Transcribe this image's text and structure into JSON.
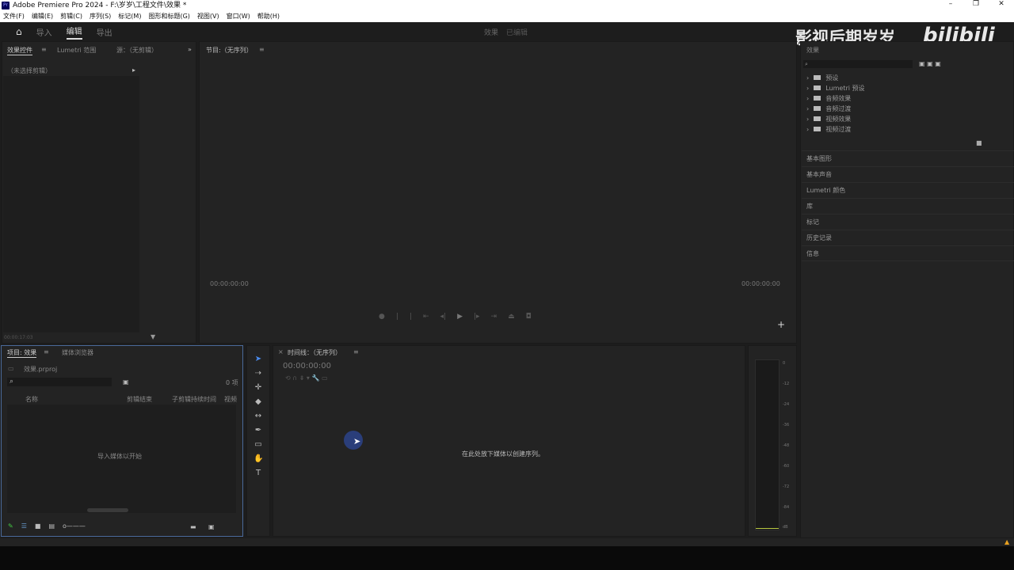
{
  "titlebar": {
    "app_badge": "Pr",
    "title": "Adobe Premiere Pro 2024 - F:\\岁岁\\工程文件\\效果 *",
    "min": "–",
    "max": "❐",
    "close": "✕"
  },
  "menu": [
    "文件(F)",
    "编辑(E)",
    "剪辑(C)",
    "序列(S)",
    "标记(M)",
    "图形和标题(G)",
    "视图(V)",
    "窗口(W)",
    "帮助(H)"
  ],
  "header": {
    "tabs": [
      "导入",
      "编辑",
      "导出"
    ],
    "center": "效果",
    "center_sub": "已编辑"
  },
  "watermark": {
    "text": "影视后期岁岁",
    "brand": "bilibili"
  },
  "effect_controls": {
    "tabs": [
      "效果控件",
      "Lumetri 范围",
      "源：（无剪辑）"
    ],
    "no_clip": "（未选择剪辑）",
    "timecode": "00:00:17:03"
  },
  "program": {
    "title": "节目:（无序列）",
    "tc_left": "00:00:00:00",
    "tc_right": "00:00:00:00"
  },
  "effects_panel": {
    "title": "效果",
    "items": [
      "预设",
      "Lumetri 预设",
      "音频效果",
      "音频过渡",
      "视频效果",
      "视频过渡"
    ],
    "sections": [
      "基本图形",
      "基本声音",
      "Lumetri 颜色",
      "库",
      "标记",
      "历史记录",
      "信息"
    ]
  },
  "project": {
    "tabs": [
      "项目: 效果",
      "媒体浏览器"
    ],
    "file": "效果.prproj",
    "count": "0 项",
    "columns": [
      "名称",
      "剪辑结束",
      "子剪辑持续时间",
      "视频"
    ],
    "empty": "导入媒体以开始"
  },
  "timeline": {
    "title": "时间线：（无序列）",
    "timecode": "00:00:00:00",
    "empty": "在此处放下媒体以创建序列。"
  },
  "meter": {
    "ticks": [
      "0",
      "-12",
      "-24",
      "-36",
      "-48",
      "-60",
      "-72",
      "-84",
      "dB"
    ]
  }
}
